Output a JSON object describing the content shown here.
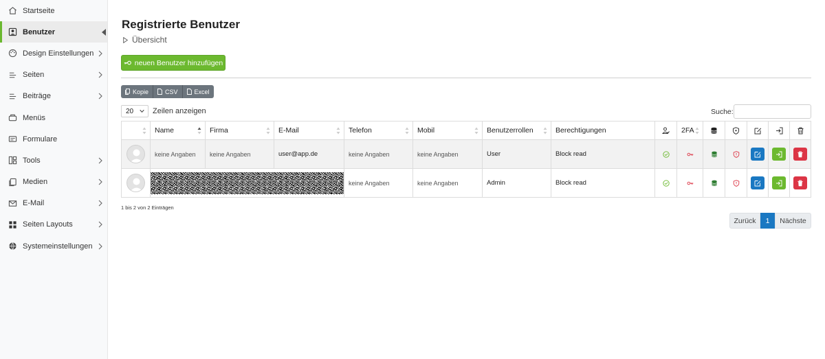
{
  "sidebar": {
    "items": [
      {
        "label": "Startseite",
        "icon": "home-icon",
        "chevron": false,
        "active": false
      },
      {
        "label": "Benutzer",
        "icon": "user-box-icon",
        "chevron": false,
        "active": true
      },
      {
        "label": "Design Einstellungen",
        "icon": "palette-icon",
        "chevron": true,
        "active": false
      },
      {
        "label": "Seiten",
        "icon": "lines-icon",
        "chevron": true,
        "active": false
      },
      {
        "label": "Beiträge",
        "icon": "lines-icon",
        "chevron": true,
        "active": false
      },
      {
        "label": "Menüs",
        "icon": "tray-icon",
        "chevron": false,
        "active": false
      },
      {
        "label": "Formulare",
        "icon": "forms-icon",
        "chevron": false,
        "active": false
      },
      {
        "label": "Tools",
        "icon": "layout-icon",
        "chevron": true,
        "active": false
      },
      {
        "label": "Medien",
        "icon": "copy-icon",
        "chevron": true,
        "active": false
      },
      {
        "label": "E-Mail",
        "icon": "mail-icon",
        "chevron": true,
        "active": false
      },
      {
        "label": "Seiten Layouts",
        "icon": "grid-icon",
        "chevron": true,
        "active": false
      },
      {
        "label": "Systemeinstellungen",
        "icon": "globe-icon",
        "chevron": true,
        "active": false
      }
    ]
  },
  "header": {
    "title": "Registrierte Benutzer",
    "subtitle": "Übersicht"
  },
  "toolbar": {
    "add_label": "neuen Benutzer hinzufügen",
    "export": [
      "Kopie",
      "CSV",
      "Excel"
    ]
  },
  "length": {
    "value": "20",
    "label": "Zeilen anzeigen"
  },
  "search": {
    "label": "Suche:",
    "value": ""
  },
  "table": {
    "headers": [
      "",
      "Name",
      "Firma",
      "E-Mail",
      "Telefon",
      "Mobil",
      "Benutzerrollen",
      "Berechtigungen",
      "",
      "2FA",
      "",
      "",
      "",
      "",
      ""
    ],
    "rows": [
      {
        "name": "keine Angaben",
        "firma": "keine Angaben",
        "email": "user@app.de",
        "telefon": "keine Angaben",
        "mobil": "keine Angaben",
        "rolle": "User",
        "berechtigung": "Block read",
        "redacted": false
      },
      {
        "name": "",
        "firma": "",
        "email": "",
        "telefon": "keine Angaben",
        "mobil": "keine Angaben",
        "rolle": "Admin",
        "berechtigung": "Block read",
        "redacted": true
      }
    ]
  },
  "footer": {
    "info": "1 bis 2 von 2 Einträgen"
  },
  "pagination": {
    "prev": "Zurück",
    "current": "1",
    "next": "Nächste"
  },
  "colors": {
    "accent_green": "#6cb92f",
    "primary_blue": "#1a78c2",
    "danger_red": "#dc3545",
    "db_green": "#2e7d32"
  }
}
